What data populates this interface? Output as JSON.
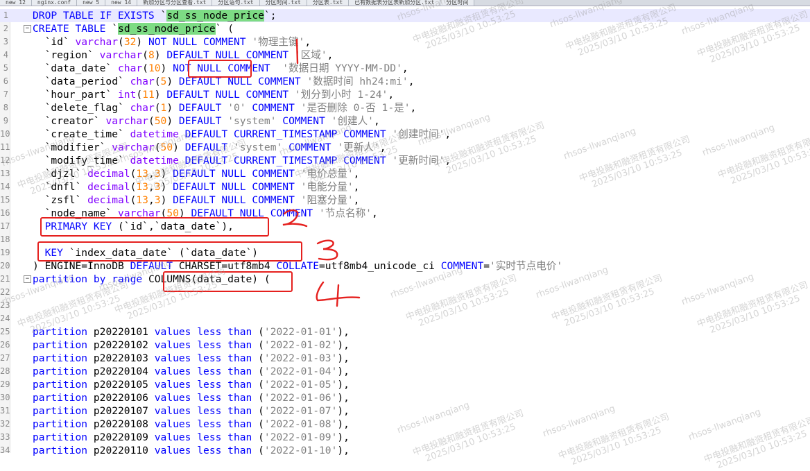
{
  "tabs": [
    "new 12",
    "nginx.conf",
    "new 5",
    "new 14",
    "新加分区与分区查看.txt",
    "分区语句.txt",
    "分区时间.txt",
    "分区表.txt",
    "已有数据表分区表新加分区.txt",
    "分区时间"
  ],
  "colors": {
    "keyword": "#0000ff",
    "type": "#8000ff",
    "number": "#ff8000",
    "string": "#808080",
    "highlight": "#7ddc84",
    "annotation": "#e5201e"
  },
  "lines": [
    {
      "n": "1",
      "segs": [
        [
          "kw",
          "DROP TABLE IF EXISTS "
        ],
        [
          "p",
          "`"
        ],
        [
          "hl",
          "sd_ss_node_price"
        ],
        [
          "p",
          "`;"
        ]
      ]
    },
    {
      "n": "2",
      "segs": [
        [
          "kw",
          "CREATE TABLE "
        ],
        [
          "p",
          "`"
        ],
        [
          "hl",
          "sd_ss_node_price"
        ],
        [
          "p",
          "` ("
        ]
      ]
    },
    {
      "n": "3",
      "segs": [
        [
          "p",
          "  `id` "
        ],
        [
          "ty",
          "varchar"
        ],
        [
          "p",
          "("
        ],
        [
          "num",
          "32"
        ],
        [
          "p",
          ") "
        ],
        [
          "kw",
          "NOT NULL COMMENT "
        ],
        [
          "str",
          "'物理主键'"
        ],
        [
          "p",
          ","
        ]
      ]
    },
    {
      "n": "4",
      "segs": [
        [
          "p",
          "  `region` "
        ],
        [
          "ty",
          "varchar"
        ],
        [
          "p",
          "("
        ],
        [
          "num",
          "8"
        ],
        [
          "p",
          ") "
        ],
        [
          "kw",
          "DEFAULT NULL COMMENT "
        ],
        [
          "str",
          "'区域'"
        ],
        [
          "p",
          ","
        ]
      ]
    },
    {
      "n": "5",
      "segs": [
        [
          "p",
          "  `data_date` "
        ],
        [
          "ty",
          "char"
        ],
        [
          "p",
          "("
        ],
        [
          "num",
          "10"
        ],
        [
          "p",
          ") "
        ],
        [
          "kw",
          "NOT NULL COMMENT  "
        ],
        [
          "str",
          "'数据日期 YYYY-MM-DD'"
        ],
        [
          "p",
          ","
        ]
      ]
    },
    {
      "n": "6",
      "segs": [
        [
          "p",
          "  `data_period` "
        ],
        [
          "ty",
          "char"
        ],
        [
          "p",
          "("
        ],
        [
          "num",
          "5"
        ],
        [
          "p",
          ") "
        ],
        [
          "kw",
          "DEFAULT NULL COMMENT "
        ],
        [
          "str",
          "'数据时间 hh24:mi'"
        ],
        [
          "p",
          ","
        ]
      ]
    },
    {
      "n": "7",
      "segs": [
        [
          "p",
          "  `hour_part` "
        ],
        [
          "ty",
          "int"
        ],
        [
          "p",
          "("
        ],
        [
          "num",
          "11"
        ],
        [
          "p",
          ") "
        ],
        [
          "kw",
          "DEFAULT NULL COMMENT "
        ],
        [
          "str",
          "'划分到小时 1-24'"
        ],
        [
          "p",
          ","
        ]
      ]
    },
    {
      "n": "8",
      "segs": [
        [
          "p",
          "  `delete_flag` "
        ],
        [
          "ty",
          "char"
        ],
        [
          "p",
          "("
        ],
        [
          "num",
          "1"
        ],
        [
          "p",
          ") "
        ],
        [
          "kw",
          "DEFAULT "
        ],
        [
          "str",
          "'0'"
        ],
        [
          "kw",
          " COMMENT "
        ],
        [
          "str",
          "'是否删除 0-否 1-是'"
        ],
        [
          "p",
          ","
        ]
      ]
    },
    {
      "n": "9",
      "segs": [
        [
          "p",
          "  `creator` "
        ],
        [
          "ty",
          "varchar"
        ],
        [
          "p",
          "("
        ],
        [
          "num",
          "50"
        ],
        [
          "p",
          ") "
        ],
        [
          "kw",
          "DEFAULT "
        ],
        [
          "str",
          "'system'"
        ],
        [
          "kw",
          " COMMENT "
        ],
        [
          "str",
          "'创建人'"
        ],
        [
          "p",
          ","
        ]
      ]
    },
    {
      "n": "10",
      "segs": [
        [
          "p",
          "  `create_time` "
        ],
        [
          "ty",
          "datetime"
        ],
        [
          "kw",
          " DEFAULT CURRENT_TIMESTAMP COMMENT "
        ],
        [
          "str",
          "'创建时间'"
        ],
        [
          "p",
          ","
        ]
      ]
    },
    {
      "n": "11",
      "segs": [
        [
          "p",
          "  `modifier` "
        ],
        [
          "ty",
          "varchar"
        ],
        [
          "p",
          "("
        ],
        [
          "num",
          "50"
        ],
        [
          "p",
          ") "
        ],
        [
          "kw",
          "DEFAULT "
        ],
        [
          "str",
          "'system'"
        ],
        [
          "kw",
          " COMMENT "
        ],
        [
          "str",
          "'更新人'"
        ],
        [
          "p",
          ","
        ]
      ]
    },
    {
      "n": "12",
      "segs": [
        [
          "p",
          "  `modify_time` "
        ],
        [
          "ty",
          "datetime"
        ],
        [
          "kw",
          " DEFAULT CURRENT_TIMESTAMP COMMENT "
        ],
        [
          "str",
          "'更新时间'"
        ],
        [
          "p",
          ","
        ]
      ]
    },
    {
      "n": "13",
      "segs": [
        [
          "p",
          "  `djzl` "
        ],
        [
          "ty",
          "decimal"
        ],
        [
          "p",
          "("
        ],
        [
          "num",
          "13"
        ],
        [
          "p",
          ","
        ],
        [
          "num",
          "3"
        ],
        [
          "p",
          ") "
        ],
        [
          "kw",
          "DEFAULT NULL COMMENT "
        ],
        [
          "str",
          "'电价总量'"
        ],
        [
          "p",
          ","
        ]
      ]
    },
    {
      "n": "14",
      "segs": [
        [
          "p",
          "  `dnfl` "
        ],
        [
          "ty",
          "decimal"
        ],
        [
          "p",
          "("
        ],
        [
          "num",
          "13"
        ],
        [
          "p",
          ","
        ],
        [
          "num",
          "3"
        ],
        [
          "p",
          ") "
        ],
        [
          "kw",
          "DEFAULT NULL COMMENT "
        ],
        [
          "str",
          "'电能分量'"
        ],
        [
          "p",
          ","
        ]
      ]
    },
    {
      "n": "15",
      "segs": [
        [
          "p",
          "  `zsfl` "
        ],
        [
          "ty",
          "decimal"
        ],
        [
          "p",
          "("
        ],
        [
          "num",
          "13"
        ],
        [
          "p",
          ","
        ],
        [
          "num",
          "3"
        ],
        [
          "p",
          ") "
        ],
        [
          "kw",
          "DEFAULT NULL COMMENT "
        ],
        [
          "str",
          "'阻塞分量'"
        ],
        [
          "p",
          ","
        ]
      ]
    },
    {
      "n": "16",
      "segs": [
        [
          "p",
          "  `node_name` "
        ],
        [
          "ty",
          "varchar"
        ],
        [
          "p",
          "("
        ],
        [
          "num",
          "50"
        ],
        [
          "p",
          ") "
        ],
        [
          "kw",
          "DEFAULT NULL COMMENT "
        ],
        [
          "str",
          "'节点名称'"
        ],
        [
          "p",
          ","
        ]
      ]
    },
    {
      "n": "17",
      "segs": [
        [
          "kw",
          "  PRIMARY KEY "
        ],
        [
          "p",
          "(`id`,`data_date`),"
        ]
      ]
    },
    {
      "n": "18",
      "segs": []
    },
    {
      "n": "19",
      "segs": [
        [
          "kw",
          "  KEY "
        ],
        [
          "p",
          "`index_data_date` (`data_date`)"
        ]
      ]
    },
    {
      "n": "20",
      "segs": [
        [
          "p",
          ") ENGINE=InnoDB "
        ],
        [
          "kw",
          "DEFAULT "
        ],
        [
          "p",
          "CHARSET=utf8mb4 "
        ],
        [
          "kw",
          "COLLATE"
        ],
        [
          "p",
          "=utf8mb4_unicode_ci "
        ],
        [
          "kw",
          "COMMENT"
        ],
        [
          "p",
          "="
        ],
        [
          "str",
          "'实时节点电价'"
        ]
      ]
    },
    {
      "n": "21",
      "segs": [
        [
          "kw",
          "partition by range "
        ],
        [
          "p",
          "COLUMNS(data_date) ("
        ]
      ]
    },
    {
      "n": "22",
      "segs": []
    },
    {
      "n": "23",
      "segs": []
    },
    {
      "n": "24",
      "segs": []
    },
    {
      "n": "25",
      "segs": [
        [
          "kw",
          "partition "
        ],
        [
          "p",
          "p20220101 "
        ],
        [
          "kw",
          "values less than "
        ],
        [
          "p",
          "("
        ],
        [
          "str",
          "'2022-01-01'"
        ],
        [
          "p",
          "),"
        ]
      ]
    },
    {
      "n": "26",
      "segs": [
        [
          "kw",
          "partition "
        ],
        [
          "p",
          "p20220102 "
        ],
        [
          "kw",
          "values less than "
        ],
        [
          "p",
          "("
        ],
        [
          "str",
          "'2022-01-02'"
        ],
        [
          "p",
          "),"
        ]
      ]
    },
    {
      "n": "27",
      "segs": [
        [
          "kw",
          "partition "
        ],
        [
          "p",
          "p20220103 "
        ],
        [
          "kw",
          "values less than "
        ],
        [
          "p",
          "("
        ],
        [
          "str",
          "'2022-01-03'"
        ],
        [
          "p",
          "),"
        ]
      ]
    },
    {
      "n": "28",
      "segs": [
        [
          "kw",
          "partition "
        ],
        [
          "p",
          "p20220104 "
        ],
        [
          "kw",
          "values less than "
        ],
        [
          "p",
          "("
        ],
        [
          "str",
          "'2022-01-04'"
        ],
        [
          "p",
          "),"
        ]
      ]
    },
    {
      "n": "29",
      "segs": [
        [
          "kw",
          "partition "
        ],
        [
          "p",
          "p20220105 "
        ],
        [
          "kw",
          "values less than "
        ],
        [
          "p",
          "("
        ],
        [
          "str",
          "'2022-01-05'"
        ],
        [
          "p",
          "),"
        ]
      ]
    },
    {
      "n": "30",
      "segs": [
        [
          "kw",
          "partition "
        ],
        [
          "p",
          "p20220106 "
        ],
        [
          "kw",
          "values less than "
        ],
        [
          "p",
          "("
        ],
        [
          "str",
          "'2022-01-06'"
        ],
        [
          "p",
          "),"
        ]
      ]
    },
    {
      "n": "31",
      "segs": [
        [
          "kw",
          "partition "
        ],
        [
          "p",
          "p20220107 "
        ],
        [
          "kw",
          "values less than "
        ],
        [
          "p",
          "("
        ],
        [
          "str",
          "'2022-01-07'"
        ],
        [
          "p",
          "),"
        ]
      ]
    },
    {
      "n": "32",
      "segs": [
        [
          "kw",
          "partition "
        ],
        [
          "p",
          "p20220108 "
        ],
        [
          "kw",
          "values less than "
        ],
        [
          "p",
          "("
        ],
        [
          "str",
          "'2022-01-08'"
        ],
        [
          "p",
          "),"
        ]
      ]
    },
    {
      "n": "33",
      "segs": [
        [
          "kw",
          "partition "
        ],
        [
          "p",
          "p20220109 "
        ],
        [
          "kw",
          "values less than "
        ],
        [
          "p",
          "("
        ],
        [
          "str",
          "'2022-01-09'"
        ],
        [
          "p",
          "),"
        ]
      ]
    },
    {
      "n": "34",
      "segs": [
        [
          "kw",
          "partition "
        ],
        [
          "p",
          "p20220110 "
        ],
        [
          "kw",
          "values less than "
        ],
        [
          "p",
          "("
        ],
        [
          "str",
          "'2022-01-10'"
        ],
        [
          "p",
          "),"
        ]
      ]
    }
  ],
  "annotations": [
    "1",
    "2",
    "3",
    "4"
  ],
  "watermark": {
    "user": "rhsos-llwanqiang",
    "company": "中电投融和融资租赁有限公司",
    "timestamp": "2025/03/10 10:53:25"
  }
}
